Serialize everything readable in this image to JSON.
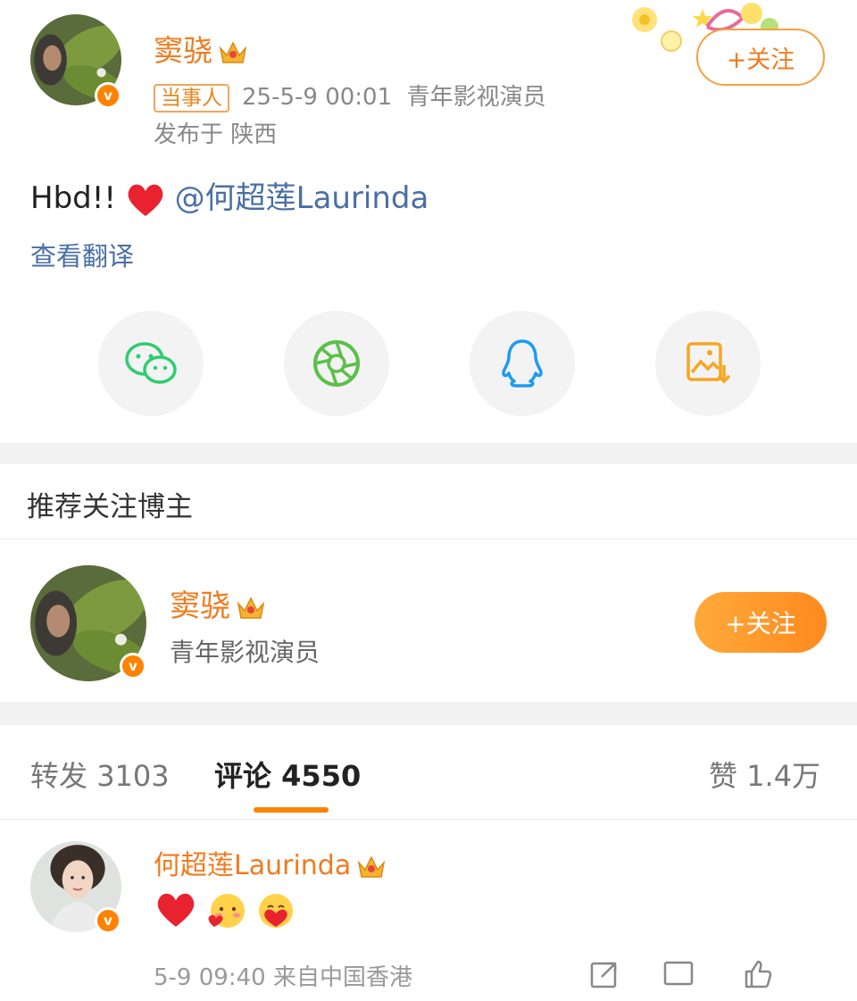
{
  "post": {
    "author": "窦骁",
    "party_tag": "当事人",
    "datetime": "25-5-9 00:01",
    "author_desc": "青年影视演员",
    "location": "发布于 陕西",
    "follow_label": "+关注",
    "text_prefix": "Hbd!!",
    "mention": "@何超莲Laurinda",
    "translate_link": "查看翻译",
    "share_icons": [
      "wechat-icon",
      "moments-icon",
      "qq-icon",
      "save-image-icon"
    ]
  },
  "recommend": {
    "title": "推荐关注博主",
    "name": "窦骁",
    "desc": "青年影视演员",
    "follow_label": "+关注"
  },
  "tabs": {
    "repost_label": "转发",
    "repost_count": "3103",
    "comment_label": "评论",
    "comment_count": "4550",
    "like_label": "赞",
    "like_count": "1.4万"
  },
  "comment": {
    "author": "何超莲Laurinda",
    "emojis": [
      "red-heart-emoji",
      "blush-heart-emoji",
      "hug-heart-emoji"
    ],
    "time": "5-9 09:40",
    "source": "来自中国香港"
  },
  "colors": {
    "accent": "#ff8200",
    "name_orange": "#f07b1f",
    "link_blue": "#4a6fa5",
    "wechat_green": "#2ecc71",
    "moments_green": "#5cbf4a",
    "qq_blue": "#1e9bf0",
    "save_orange": "#f5a623"
  }
}
